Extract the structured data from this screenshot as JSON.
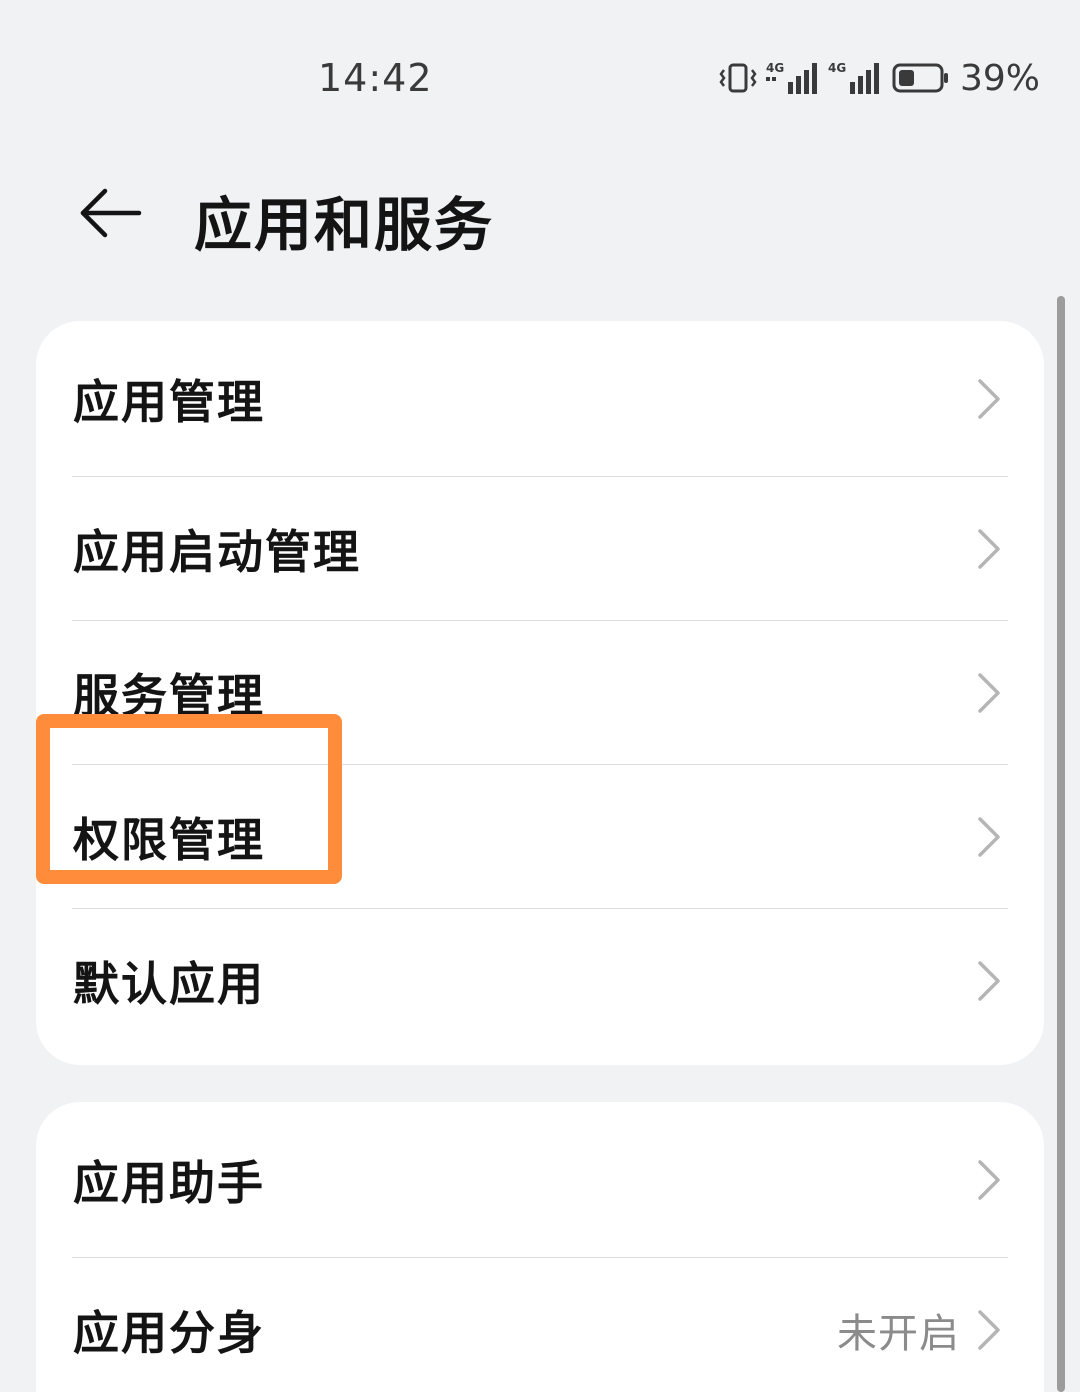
{
  "status_bar": {
    "time": "14:42",
    "battery_percent": "39%",
    "battery_level": 0.39,
    "icons": [
      "vibrate-icon",
      "signal-4g-sim1-icon",
      "signal-4g-sim2-icon",
      "battery-icon"
    ],
    "network_label_1": "4G",
    "network_label_2": "4G"
  },
  "header": {
    "title": "应用和服务",
    "back_icon": "back-arrow-icon"
  },
  "groups": [
    {
      "items": [
        {
          "label": "应用管理",
          "value": ""
        },
        {
          "label": "应用启动管理",
          "value": ""
        },
        {
          "label": "服务管理",
          "value": ""
        },
        {
          "label": "权限管理",
          "value": ""
        },
        {
          "label": "默认应用",
          "value": ""
        }
      ]
    },
    {
      "items": [
        {
          "label": "应用助手",
          "value": ""
        },
        {
          "label": "应用分身",
          "value": "未开启"
        }
      ]
    }
  ],
  "highlight": {
    "target": "权限管理",
    "color": "#ff8c3b"
  },
  "colors": {
    "background": "#f1f2f4",
    "card": "#ffffff",
    "text_primary": "#141414",
    "text_secondary": "#8b8b8b",
    "chevron": "#b5b5b5"
  }
}
